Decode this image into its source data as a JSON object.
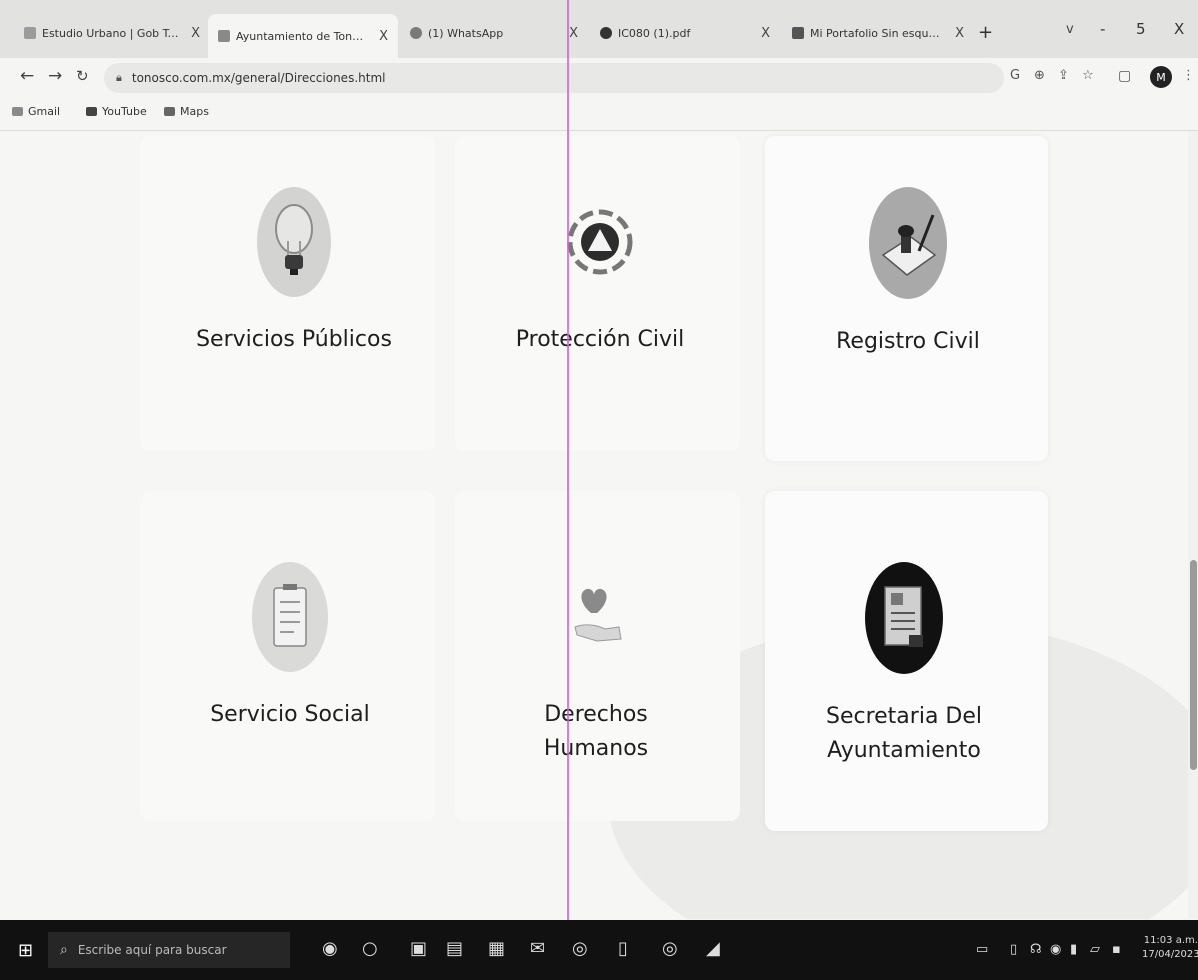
{
  "browser": {
    "tabs": [
      {
        "title": "Estudio Urbano | Gob Toronto",
        "active": false
      },
      {
        "title": "Ayuntamiento de Tonosco",
        "active": true
      },
      {
        "title": "(1) WhatsApp",
        "active": false
      },
      {
        "title": "IC080 (1).pdf",
        "active": false
      },
      {
        "title": "Mi Portafolio Sin esquemasX",
        "active": false
      }
    ],
    "tab_close": "X",
    "new_tab": "+",
    "tab_search": "v",
    "window_controls": {
      "minimize": "-",
      "maximize": "5",
      "close": "X"
    },
    "address": "tonosco.com.mx/general/Direcciones.html",
    "bookmarks": [
      "Gmail",
      "YouTube",
      "Maps"
    ],
    "profile_initial": "M"
  },
  "main": {
    "services": [
      {
        "label": "Servicios Públicos",
        "icon": "lightbulb-icon"
      },
      {
        "label": "Protección Civil",
        "icon": "civil-protection-icon"
      },
      {
        "label": "Registro Civil",
        "icon": "registry-stamp-icon"
      },
      {
        "label": "Servicio Social",
        "icon": "clipboard-icon"
      },
      {
        "label": "Derechos Humanos",
        "icon": "heart-hand-icon"
      },
      {
        "label": "Secretaria Del Ayuntamiento",
        "icon": "document-icon"
      }
    ]
  },
  "taskbar": {
    "search_placeholder": "Escribe aquí para buscar",
    "time": "11:03 a.m.",
    "date": "17/04/2023"
  }
}
